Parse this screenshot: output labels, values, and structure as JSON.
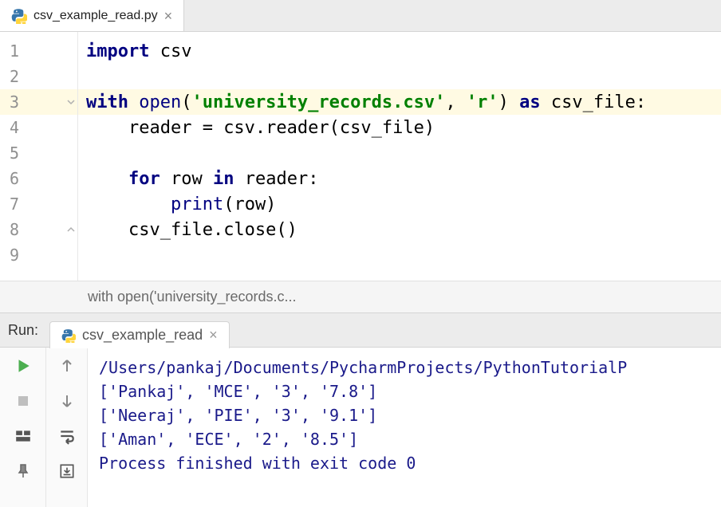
{
  "tab": {
    "filename": "csv_example_read.py"
  },
  "editor": {
    "lines": [
      {
        "num": "1",
        "highlight": false
      },
      {
        "num": "2",
        "highlight": false
      },
      {
        "num": "3",
        "highlight": true
      },
      {
        "num": "4",
        "highlight": false
      },
      {
        "num": "5",
        "highlight": false
      },
      {
        "num": "6",
        "highlight": false
      },
      {
        "num": "7",
        "highlight": false
      },
      {
        "num": "8",
        "highlight": false
      },
      {
        "num": "9",
        "highlight": false
      }
    ],
    "code": {
      "l1": {
        "kw1": "import",
        "sp1": " ",
        "id1": "csv"
      },
      "l3": {
        "kw1": "with",
        "sp1": " ",
        "bi1": "open",
        "p1": "(",
        "str1": "'university_records.csv'",
        "p2": ", ",
        "str2": "'r'",
        "p3": ") ",
        "kw2": "as",
        "sp2": " ",
        "id1": "csv_file:",
        "indent": ""
      },
      "l4": {
        "indent": "    ",
        "id1": "reader = csv.reader(csv_file)"
      },
      "l6": {
        "indent": "    ",
        "kw1": "for",
        "sp1": " ",
        "id1": "row ",
        "kw2": "in",
        "sp2": " ",
        "id2": "reader:"
      },
      "l7": {
        "indent": "        ",
        "bi1": "print",
        "id1": "(row)"
      },
      "l8": {
        "indent": "    ",
        "id1": "csv_file.close()"
      }
    }
  },
  "breadcrumb": {
    "text": "with open('university_records.c..."
  },
  "run": {
    "label": "Run:",
    "tab_name": "csv_example_read",
    "console": {
      "l1": "/Users/pankaj/Documents/PycharmProjects/PythonTutorialP",
      "l2": "['Pankaj', 'MCE', '3', '7.8']",
      "l3": "['Neeraj', 'PIE', '3', '9.1']",
      "l4": "['Aman', 'ECE', '2', '8.5']",
      "l5": "",
      "l6": "Process finished with exit code 0"
    }
  }
}
